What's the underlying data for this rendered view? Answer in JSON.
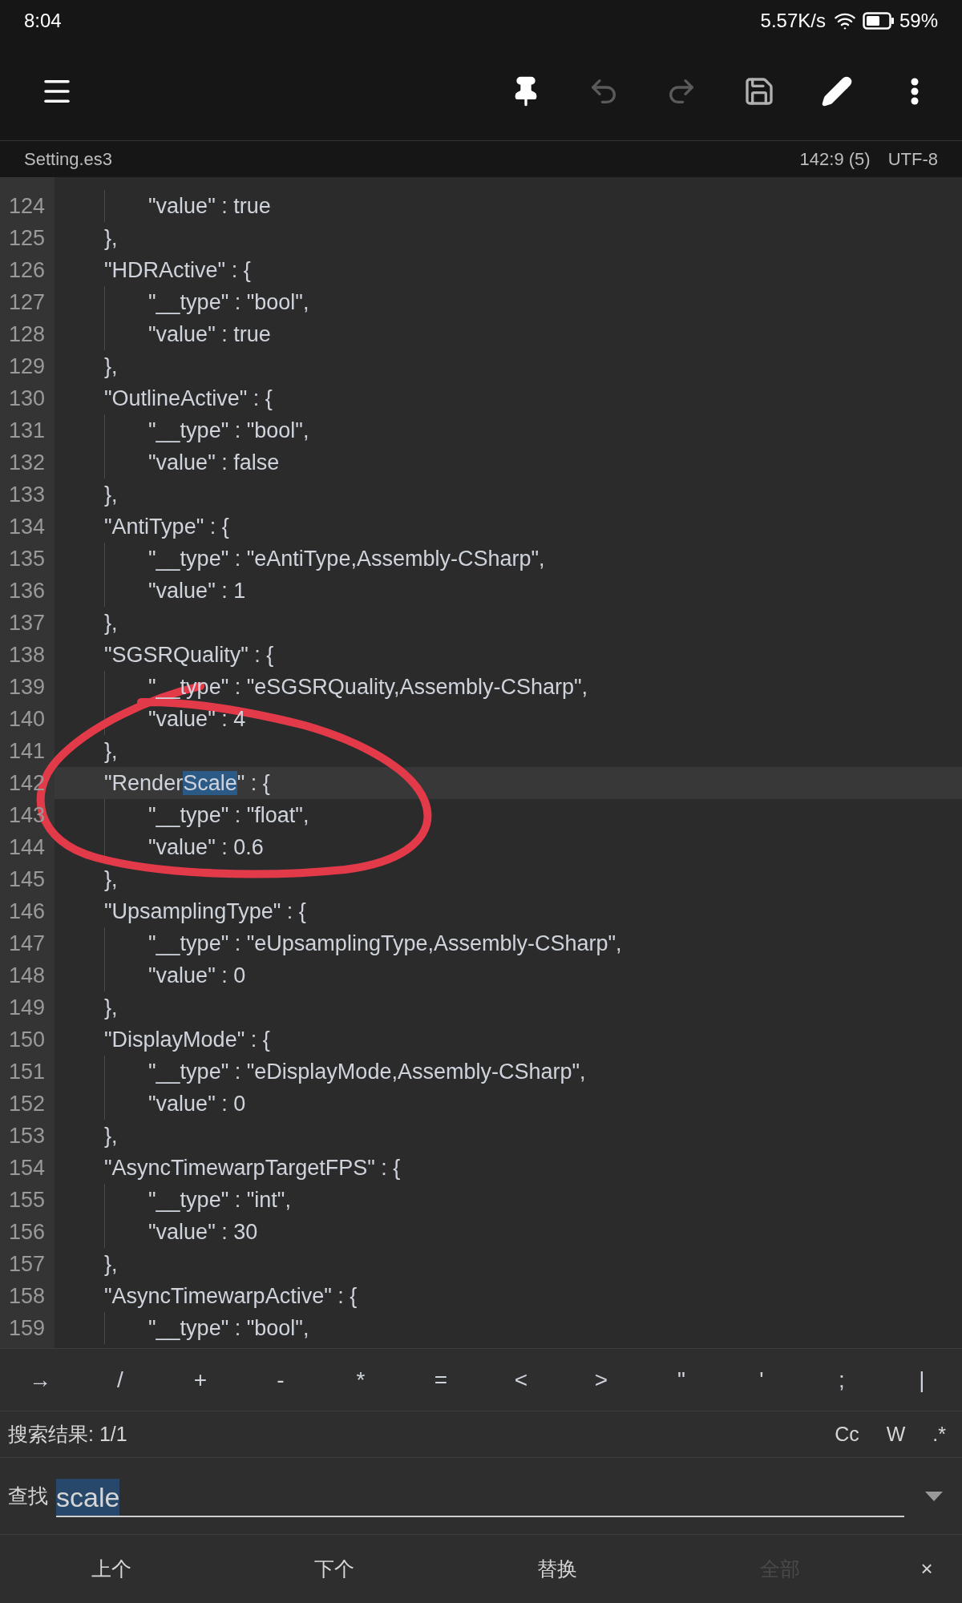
{
  "status_bar": {
    "time": "8:04",
    "net_speed": "5.57K/s",
    "battery": "59%"
  },
  "toolbar": {
    "actions": [
      {
        "kind": "pin",
        "disabled": false
      },
      {
        "kind": "undo",
        "disabled": true
      },
      {
        "kind": "redo",
        "disabled": true
      },
      {
        "kind": "save",
        "disabled": false
      },
      {
        "kind": "edit",
        "disabled": false
      },
      {
        "kind": "more",
        "disabled": false
      }
    ]
  },
  "file_bar": {
    "file_name": "Setting.es3",
    "position": "142:9 (5)",
    "encoding": "UTF-8"
  },
  "editor": {
    "lines": [
      {
        "number": "124",
        "kind": "field",
        "current": false,
        "text": "\"value\" : true"
      },
      {
        "number": "125",
        "kind": "close",
        "current": false,
        "text": "},"
      },
      {
        "number": "126",
        "kind": "open",
        "current": false,
        "text": "\"HDRActive\" : {"
      },
      {
        "number": "127",
        "kind": "field",
        "current": false,
        "text": "\"__type\" : \"bool\","
      },
      {
        "number": "128",
        "kind": "field",
        "current": false,
        "text": "\"value\" : true"
      },
      {
        "number": "129",
        "kind": "close",
        "current": false,
        "text": "},"
      },
      {
        "number": "130",
        "kind": "open",
        "current": false,
        "text": "\"OutlineActive\" : {"
      },
      {
        "number": "131",
        "kind": "field",
        "current": false,
        "text": "\"__type\" : \"bool\","
      },
      {
        "number": "132",
        "kind": "field",
        "current": false,
        "text": "\"value\" : false"
      },
      {
        "number": "133",
        "kind": "close",
        "current": false,
        "text": "},"
      },
      {
        "number": "134",
        "kind": "open",
        "current": false,
        "text": "\"AntiType\" : {"
      },
      {
        "number": "135",
        "kind": "field",
        "current": false,
        "text": "\"__type\" : \"eAntiType,Assembly-CSharp\","
      },
      {
        "number": "136",
        "kind": "field",
        "current": false,
        "text": "\"value\" : 1"
      },
      {
        "number": "137",
        "kind": "close",
        "current": false,
        "text": "},"
      },
      {
        "number": "138",
        "kind": "open",
        "current": false,
        "text": "\"SGSRQuality\" : {"
      },
      {
        "number": "139",
        "kind": "field",
        "current": false,
        "text": "\"__type\" : \"eSGSRQuality,Assembly-CSharp\","
      },
      {
        "number": "140",
        "kind": "field",
        "current": false,
        "text": "\"value\" : 4"
      },
      {
        "number": "141",
        "kind": "close",
        "current": false,
        "text": "},"
      },
      {
        "number": "142",
        "kind": "open",
        "current": true,
        "segments": [
          {
            "text": "\"Render",
            "match": false
          },
          {
            "text": "Scale",
            "match": true
          },
          {
            "text": "\" : {",
            "match": false
          }
        ]
      },
      {
        "number": "143",
        "kind": "field",
        "current": false,
        "text": "\"__type\" : \"float\","
      },
      {
        "number": "144",
        "kind": "field",
        "current": false,
        "text": "\"value\" : 0.6"
      },
      {
        "number": "145",
        "kind": "close",
        "current": false,
        "text": "},"
      },
      {
        "number": "146",
        "kind": "open",
        "current": false,
        "text": "\"UpsamplingType\" : {"
      },
      {
        "number": "147",
        "kind": "field",
        "current": false,
        "text": "\"__type\" : \"eUpsamplingType,Assembly-CSharp\","
      },
      {
        "number": "148",
        "kind": "field",
        "current": false,
        "text": "\"value\" : 0"
      },
      {
        "number": "149",
        "kind": "close",
        "current": false,
        "text": "},"
      },
      {
        "number": "150",
        "kind": "open",
        "current": false,
        "text": "\"DisplayMode\" : {"
      },
      {
        "number": "151",
        "kind": "field",
        "current": false,
        "text": "\"__type\" : \"eDisplayMode,Assembly-CSharp\","
      },
      {
        "number": "152",
        "kind": "field",
        "current": false,
        "text": "\"value\" : 0"
      },
      {
        "number": "153",
        "kind": "close",
        "current": false,
        "text": "},"
      },
      {
        "number": "154",
        "kind": "open",
        "current": false,
        "text": "\"AsyncTimewarpTargetFPS\" : {"
      },
      {
        "number": "155",
        "kind": "field",
        "current": false,
        "text": "\"__type\" : \"int\","
      },
      {
        "number": "156",
        "kind": "field",
        "current": false,
        "text": "\"value\" : 30"
      },
      {
        "number": "157",
        "kind": "close",
        "current": false,
        "text": "},"
      },
      {
        "number": "158",
        "kind": "open",
        "current": false,
        "text": "\"AsyncTimewarpActive\" : {"
      },
      {
        "number": "159",
        "kind": "field",
        "current": false,
        "text": "\"__type\" : \"bool\","
      }
    ]
  },
  "symbol_keys": [
    "→",
    "/",
    "+",
    "-",
    "*",
    "=",
    "<",
    ">",
    "\"",
    "'",
    ";",
    "|"
  ],
  "search": {
    "result": "搜索结果: 1/1",
    "options": [
      {
        "label": "Cc",
        "selected": false
      },
      {
        "label": "W",
        "selected": false
      },
      {
        "label": ".*",
        "selected": false
      }
    ],
    "find_label": "查找",
    "value": "scale",
    "value_selected": true
  },
  "search_actions": [
    {
      "label": "上个",
      "disabled": false
    },
    {
      "label": "下个",
      "disabled": false
    },
    {
      "label": "替换",
      "disabled": false
    },
    {
      "label": "全部",
      "disabled": true
    }
  ],
  "close_label": "×"
}
